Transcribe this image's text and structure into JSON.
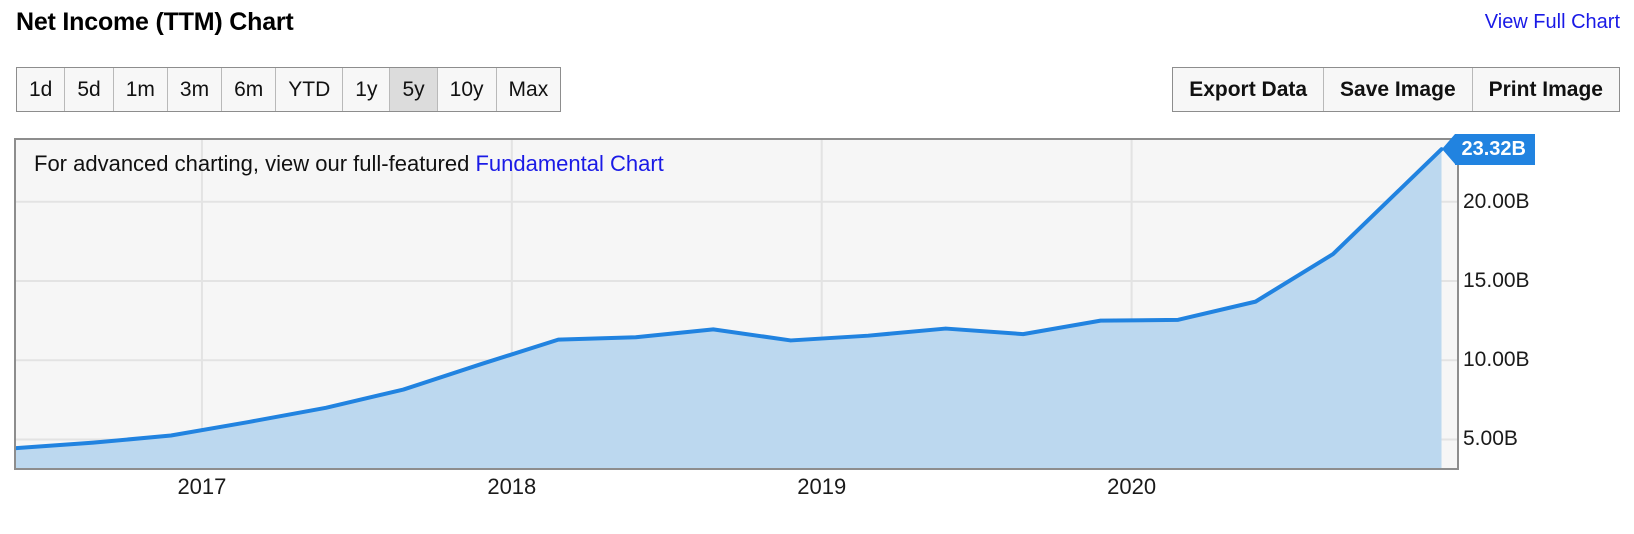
{
  "header": {
    "title": "Net Income (TTM) Chart",
    "view_full_chart_label": "View Full Chart"
  },
  "range_selector": {
    "active": "5y",
    "options": [
      {
        "label": "1d"
      },
      {
        "label": "5d"
      },
      {
        "label": "1m"
      },
      {
        "label": "3m"
      },
      {
        "label": "6m"
      },
      {
        "label": "YTD"
      },
      {
        "label": "1y"
      },
      {
        "label": "5y"
      },
      {
        "label": "10y"
      },
      {
        "label": "Max"
      }
    ]
  },
  "actions": [
    {
      "label": "Export Data"
    },
    {
      "label": "Save Image"
    },
    {
      "label": "Print Image"
    }
  ],
  "chart_note": {
    "prefix": "For advanced charting, view our full-featured ",
    "link_label": "Fundamental Chart"
  },
  "latest_value_badge": "23.32B",
  "colors": {
    "line": "#2183e0",
    "area_fill": "#bcd8ef",
    "plot_background": "#f6f6f6",
    "grid": "#e3e3e3",
    "border": "#8d8d8d",
    "link": "#1a1ae6",
    "badge": "#2183e0",
    "active_button": "#dcdcdc"
  },
  "chart_data": {
    "type": "area",
    "title": "Net Income (TTM) Chart",
    "xlabel": "",
    "ylabel": "",
    "unit": "B",
    "grid": true,
    "legend": "none",
    "xlim": [
      2016.4,
      2021.05
    ],
    "ylim": [
      3.2,
      23.9
    ],
    "yticks": [
      5,
      10,
      15,
      20
    ],
    "ytick_labels": [
      "5.00B",
      "10.00B",
      "15.00B",
      "20.00B"
    ],
    "xticks": [
      2017,
      2018,
      2019,
      2020
    ],
    "xtick_labels": [
      "2017",
      "2018",
      "2019",
      "2020"
    ],
    "series": [
      {
        "name": "Net Income (TTM)",
        "points": [
          {
            "x": 2016.4,
            "y": 4.45
          },
          {
            "x": 2016.65,
            "y": 4.8
          },
          {
            "x": 2016.9,
            "y": 5.25
          },
          {
            "x": 2017.15,
            "y": 6.1
          },
          {
            "x": 2017.4,
            "y": 7.0
          },
          {
            "x": 2017.65,
            "y": 8.15
          },
          {
            "x": 2017.9,
            "y": 9.75
          },
          {
            "x": 2018.15,
            "y": 11.3
          },
          {
            "x": 2018.4,
            "y": 11.45
          },
          {
            "x": 2018.65,
            "y": 11.95
          },
          {
            "x": 2018.9,
            "y": 11.25
          },
          {
            "x": 2019.15,
            "y": 11.55
          },
          {
            "x": 2019.4,
            "y": 12.0
          },
          {
            "x": 2019.65,
            "y": 11.65
          },
          {
            "x": 2019.9,
            "y": 12.5
          },
          {
            "x": 2020.15,
            "y": 12.55
          },
          {
            "x": 2020.4,
            "y": 13.7
          },
          {
            "x": 2020.65,
            "y": 16.7
          },
          {
            "x": 2021.0,
            "y": 23.32
          }
        ]
      }
    ],
    "annotations": [
      {
        "type": "value-badge",
        "text": "23.32B",
        "at_x": 2021.0,
        "at_y": 23.32
      }
    ]
  }
}
